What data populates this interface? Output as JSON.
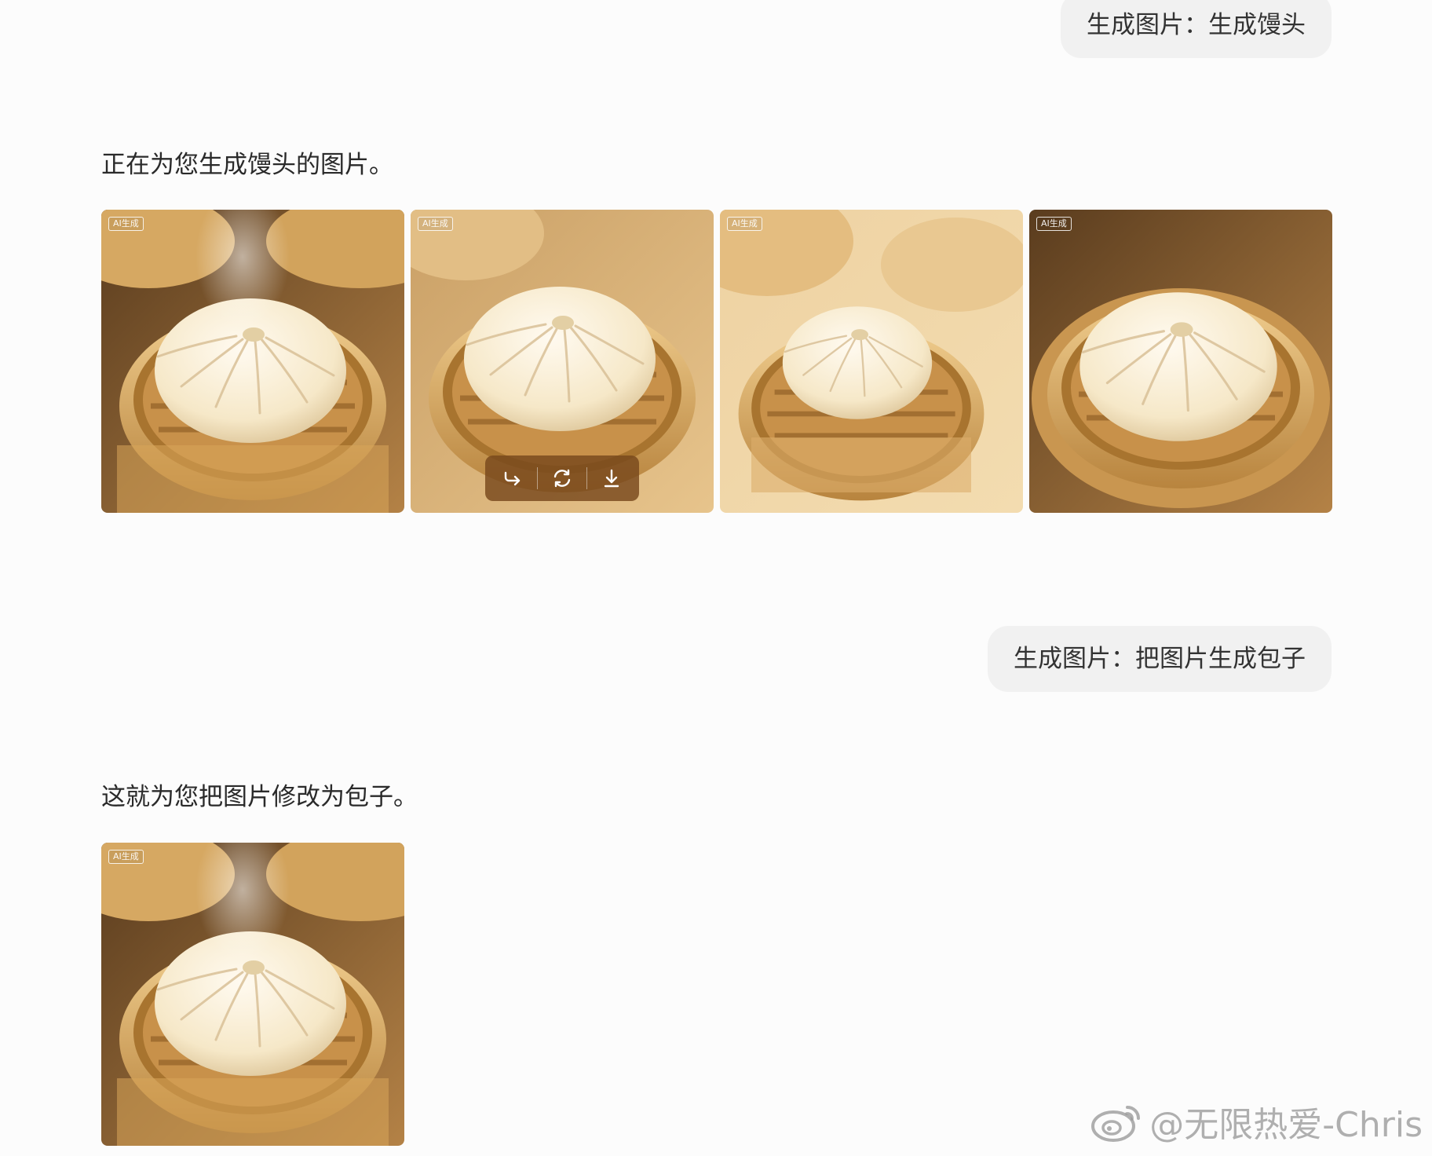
{
  "conversation": {
    "user_message_1": "生成图片：生成馒头",
    "assistant_reply_1": "正在为您生成馒头的图片。",
    "user_message_2": "生成图片：把图片生成包子",
    "assistant_reply_2": "这就为您把图片修改为包子。"
  },
  "images": {
    "badge_label": "AI生成",
    "subject": "steamed-bun-in-bamboo-steamer",
    "gallery_1_count": 4,
    "gallery_2_count": 1
  },
  "image_toolbar": {
    "icons": [
      "share-icon",
      "regenerate-icon",
      "download-icon"
    ]
  },
  "watermark": {
    "text": "@无限热爱-Chris",
    "icon": "weibo-logo"
  },
  "colors": {
    "background": "#fcfcfc",
    "bubble": "#f1f1f1",
    "toolbar": "#7a4a1e",
    "bamboo": "#d9a65a",
    "bun": "#f7ecd2"
  }
}
